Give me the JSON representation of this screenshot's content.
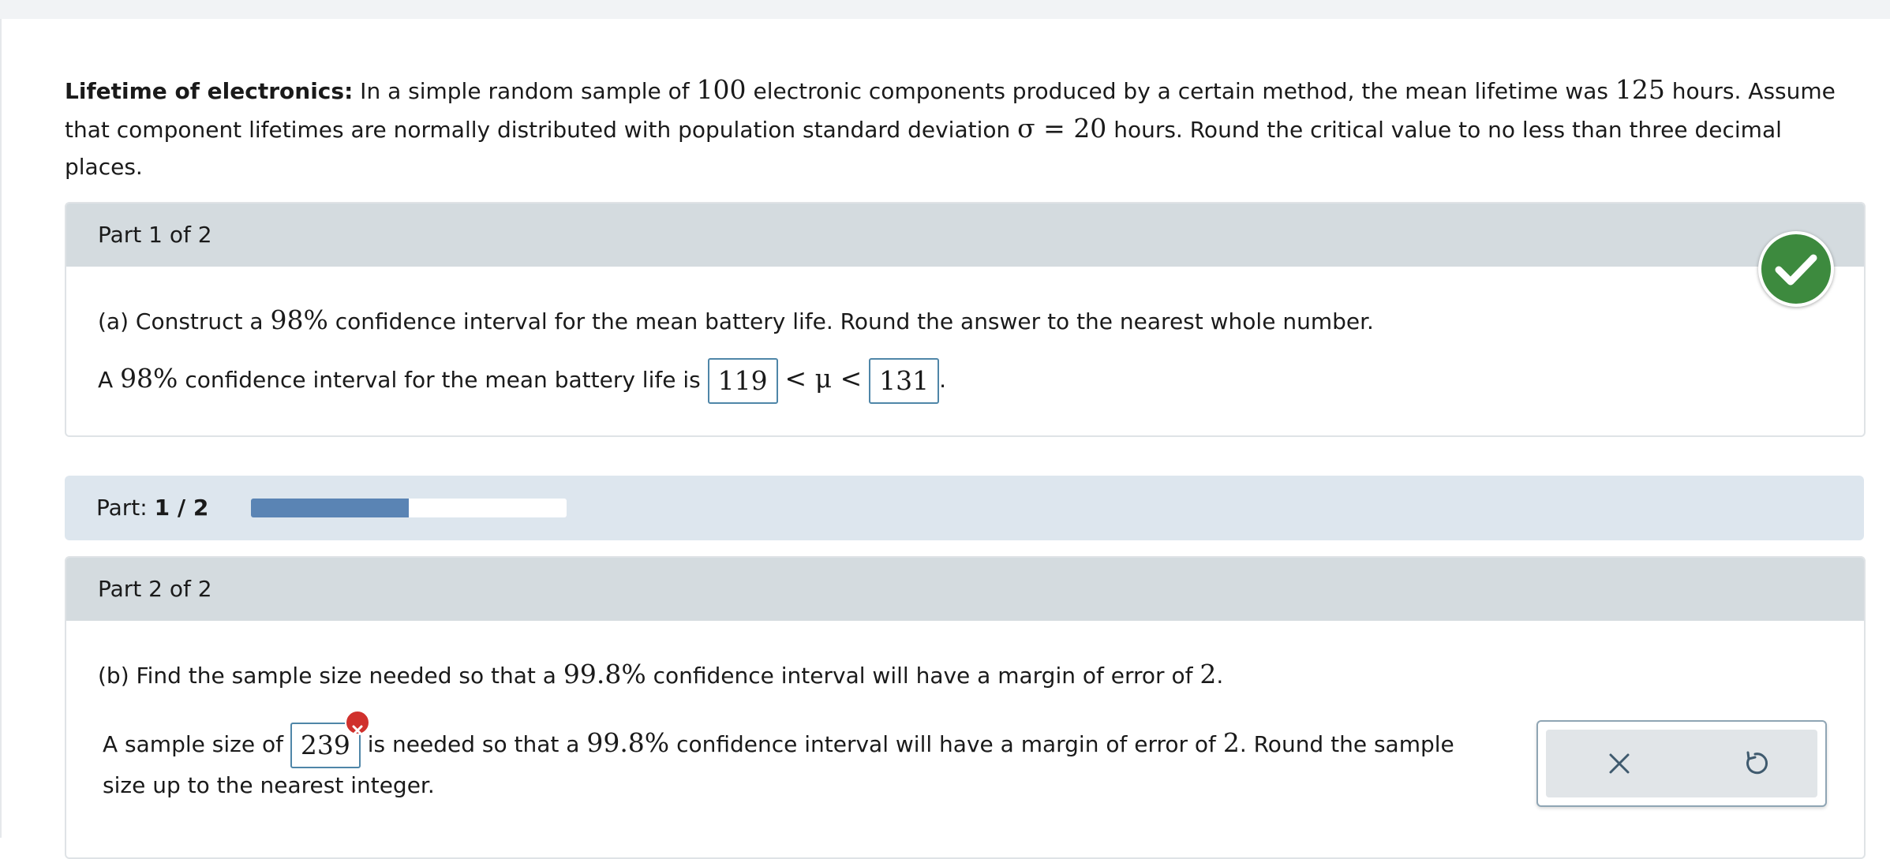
{
  "problem": {
    "title": "Lifetime of electronics:",
    "text_1": " In a simple random sample of ",
    "n": "100",
    "text_2": " electronic components produced by a certain method, the mean lifetime was ",
    "mean": "125",
    "text_3": " hours. Assume that component lifetimes are normally distributed with population standard deviation ",
    "sigma_expr": "σ = 20",
    "text_4": " hours. Round the critical value to no less than three decimal places."
  },
  "part1": {
    "title": "Part 1 of 2",
    "question_pre": "(a) Construct a ",
    "question_pct": "98%",
    "question_post": " confidence interval for the mean battery life. Round the answer to the nearest whole number.",
    "answer_pre": "A ",
    "answer_pct": "98%",
    "answer_mid": " confidence interval for the mean battery life is ",
    "lower": "119",
    "between": "< μ <",
    "upper": "131",
    "end": ".",
    "status": "correct"
  },
  "progress": {
    "label": "Part: ",
    "value_text": "1 / 2",
    "fraction": 0.5
  },
  "part2": {
    "title": "Part 2 of 2",
    "question_pre": "(b) Find the sample size needed so that a ",
    "question_pct": "99.8%",
    "question_mid": " confidence interval will have a margin of error of ",
    "question_moe": "2",
    "question_end": ".",
    "answer_pre": "A sample size of ",
    "answer_value": "239",
    "answer_mid": " is needed so that a ",
    "answer_pct": "99.8%",
    "answer_mid2": " confidence interval will have a margin of error of ",
    "answer_moe": "2",
    "answer_post": ". Round the sample",
    "answer_line2": "size up to the nearest integer.",
    "status": "incorrect"
  },
  "tools": {
    "clear_icon": "close-icon",
    "undo_icon": "undo-icon"
  },
  "colors": {
    "correct": "#3d8a3e",
    "incorrect": "#d0312d",
    "progress": "#5a84b4"
  }
}
